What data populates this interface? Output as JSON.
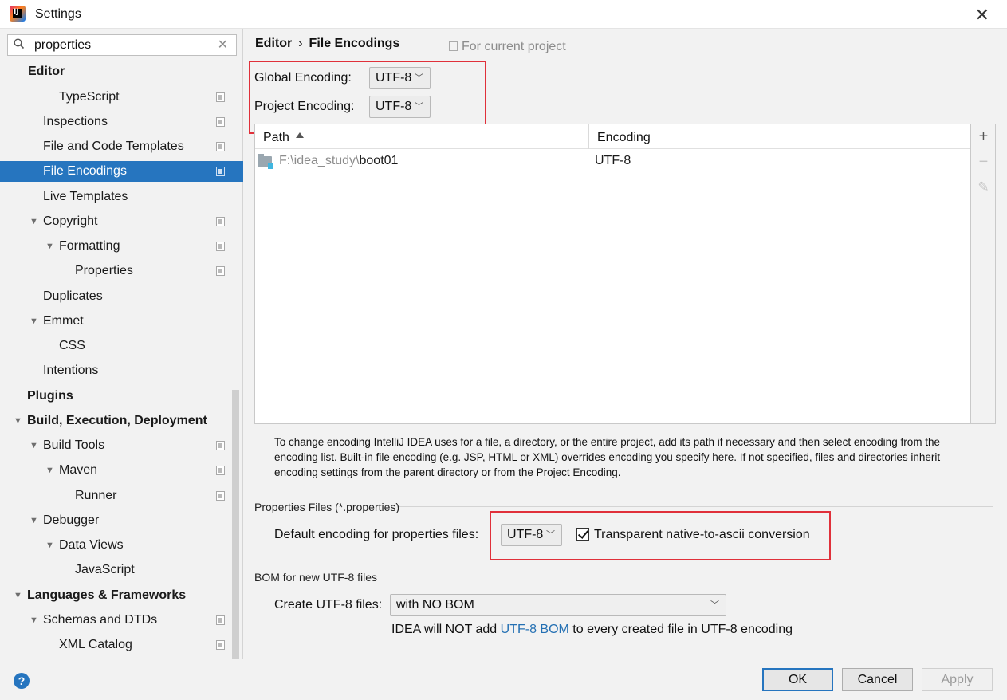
{
  "window": {
    "title": "Settings"
  },
  "search": {
    "value": "properties"
  },
  "sidebar": {
    "items": [
      {
        "label": "Editor"
      },
      {
        "label": "TypeScript"
      },
      {
        "label": "Inspections"
      },
      {
        "label": "File and Code Templates"
      },
      {
        "label": "File Encodings"
      },
      {
        "label": "Live Templates"
      },
      {
        "label": "Copyright"
      },
      {
        "label": "Formatting"
      },
      {
        "label": "Properties"
      },
      {
        "label": "Duplicates"
      },
      {
        "label": "Emmet"
      },
      {
        "label": "CSS"
      },
      {
        "label": "Intentions"
      },
      {
        "label": "Plugins"
      },
      {
        "label": "Build, Execution, Deployment"
      },
      {
        "label": "Build Tools"
      },
      {
        "label": "Maven"
      },
      {
        "label": "Runner"
      },
      {
        "label": "Debugger"
      },
      {
        "label": "Data Views"
      },
      {
        "label": "JavaScript"
      },
      {
        "label": "Languages & Frameworks"
      },
      {
        "label": "Schemas and DTDs"
      },
      {
        "label": "XML Catalog"
      }
    ]
  },
  "breadcrumb": {
    "parent": "Editor",
    "current": "File Encodings",
    "scope": "For current project"
  },
  "encodings": {
    "global_label": "Global Encoding:",
    "global_value": "UTF-8",
    "project_label": "Project Encoding:",
    "project_value": "UTF-8"
  },
  "table": {
    "col_path": "Path",
    "col_encoding": "Encoding",
    "rows": [
      {
        "path_prefix": "F:\\idea_study\\",
        "path_name": "boot01",
        "encoding": "UTF-8"
      }
    ]
  },
  "help_text": "To change encoding IntelliJ IDEA uses for a file, a directory, or the entire project, add its path if necessary and then select encoding from the encoding list. Built-in file encoding (e.g. JSP, HTML or XML) overrides encoding you specify here. If not specified, files and directories inherit encoding settings from the parent directory or from the Project Encoding.",
  "properties_files": {
    "section_title": "Properties Files (*.properties)",
    "default_label": "Default encoding for properties files:",
    "default_value": "UTF-8",
    "native_ascii_label": "Transparent native-to-ascii conversion",
    "native_ascii_checked": true
  },
  "bom": {
    "section_title": "BOM for new UTF-8 files",
    "create_label": "Create UTF-8 files:",
    "create_value": "with NO BOM",
    "note_prefix": "IDEA will NOT add ",
    "note_link": "UTF-8 BOM",
    "note_suffix": " to every created file in UTF-8 encoding"
  },
  "buttons": {
    "ok": "OK",
    "cancel": "Cancel",
    "apply": "Apply",
    "help": "?"
  },
  "colors": {
    "selection": "#2675bf",
    "highlight_box": "#e0303a",
    "link": "#2470b3"
  }
}
